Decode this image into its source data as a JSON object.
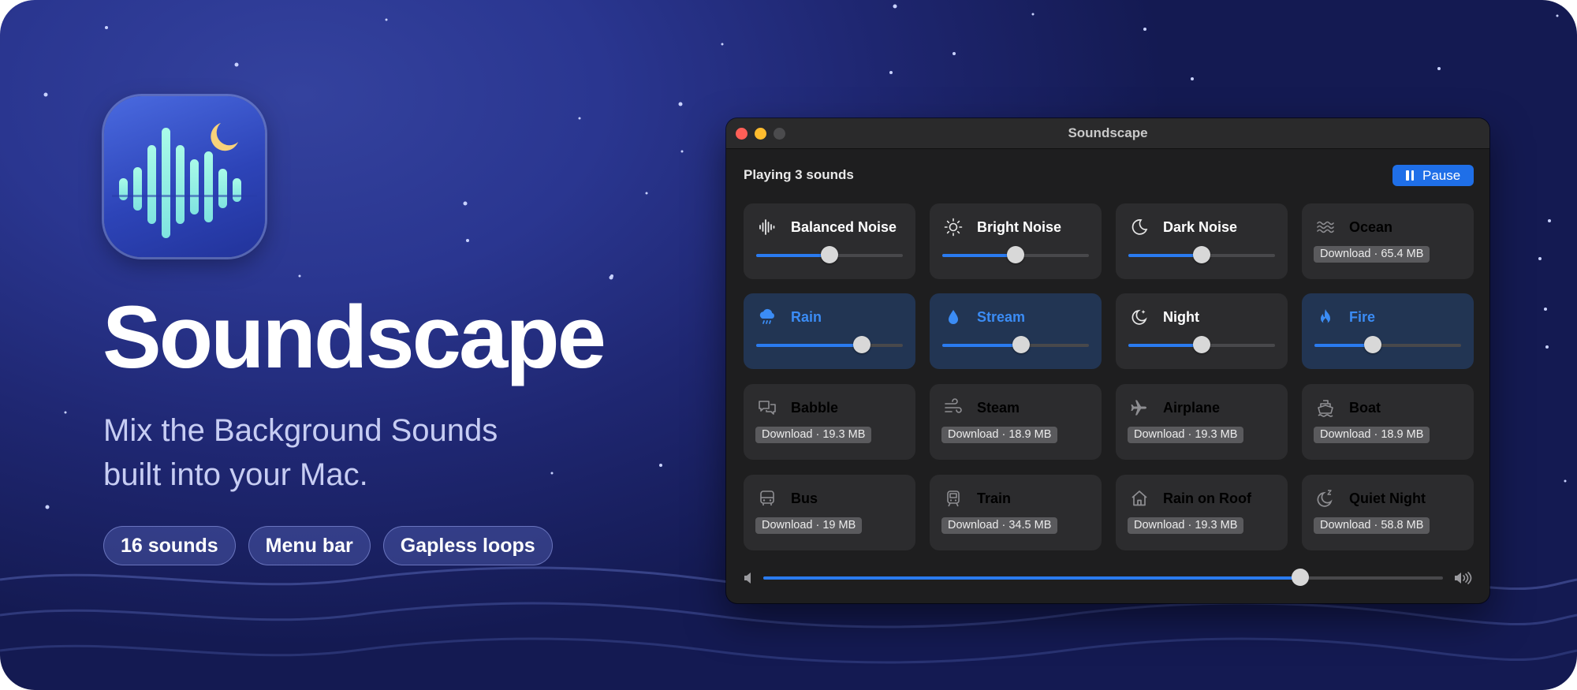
{
  "hero": {
    "title": "Soundscape",
    "tagline_line1": "Mix the Background Sounds",
    "tagline_line2": "built into your Mac.",
    "pills": [
      "16 sounds",
      "Menu bar",
      "Gapless loops"
    ]
  },
  "window": {
    "title": "Soundscape",
    "status": "Playing 3 sounds",
    "pause_label": "Pause",
    "master_volume": 0.79
  },
  "sounds": [
    {
      "label": "Balanced Noise",
      "icon": "waveform-icon",
      "state": "on",
      "volume": 0.5
    },
    {
      "label": "Bright Noise",
      "icon": "sun-icon",
      "state": "on",
      "volume": 0.5
    },
    {
      "label": "Dark Noise",
      "icon": "moon-icon",
      "state": "on",
      "volume": 0.5
    },
    {
      "label": "Ocean",
      "icon": "waves-icon",
      "state": "download",
      "download": "Download · 65.4 MB"
    },
    {
      "label": "Rain",
      "icon": "cloud-rain-icon",
      "state": "active",
      "volume": 0.72
    },
    {
      "label": "Stream",
      "icon": "drop-icon",
      "state": "active",
      "volume": 0.54
    },
    {
      "label": "Night",
      "icon": "moon-stars-icon",
      "state": "on",
      "volume": 0.5
    },
    {
      "label": "Fire",
      "icon": "flame-icon",
      "state": "active",
      "volume": 0.4
    },
    {
      "label": "Babble",
      "icon": "speech-bubbles-icon",
      "state": "download",
      "download": "Download · 19.3 MB"
    },
    {
      "label": "Steam",
      "icon": "wind-icon",
      "state": "download",
      "download": "Download · 18.9 MB"
    },
    {
      "label": "Airplane",
      "icon": "airplane-icon",
      "state": "download",
      "download": "Download · 19.3 MB"
    },
    {
      "label": "Boat",
      "icon": "ferry-icon",
      "state": "download",
      "download": "Download · 18.9 MB"
    },
    {
      "label": "Bus",
      "icon": "bus-icon",
      "state": "download",
      "download": "Download · 19 MB"
    },
    {
      "label": "Train",
      "icon": "tram-icon",
      "state": "download",
      "download": "Download · 34.5 MB"
    },
    {
      "label": "Rain on Roof",
      "icon": "house-icon",
      "state": "download",
      "download": "Download · 19.3 MB"
    },
    {
      "label": "Quiet Night",
      "icon": "moon-zzz-icon",
      "state": "download",
      "download": "Download · 58.8 MB"
    }
  ],
  "colors": {
    "accent": "#1f6fe8",
    "active_label": "#3b8cf5",
    "active_card": "#223553",
    "card": "#2c2c2e"
  }
}
